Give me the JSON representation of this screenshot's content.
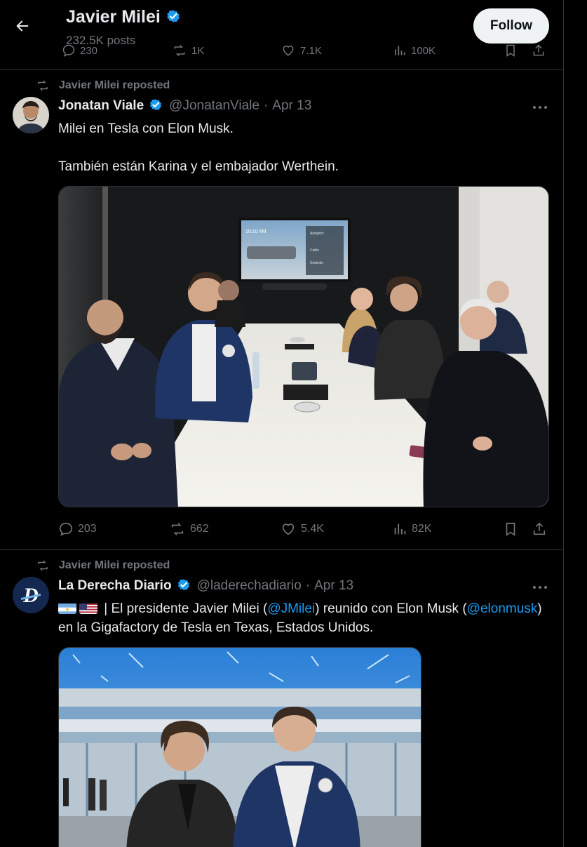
{
  "header": {
    "name": "Javier Milei",
    "posts": "232.5K posts",
    "follow_label": "Follow",
    "prev_counts": {
      "replies": "230",
      "reposts": "1K",
      "likes": "7.1K",
      "views": "100K"
    }
  },
  "tweets": [
    {
      "repost_label": "Javier Milei reposted",
      "author_name": "Jonatan Viale",
      "handle": "@JonatanViale",
      "separator": "·",
      "date": "Apr 13",
      "text_line1": "Milei en Tesla con Elon Musk.",
      "text_line2": "También están Karina y el embajador Werthein.",
      "actions": {
        "replies": "203",
        "reposts": "662",
        "likes": "5.4K",
        "views": "82K"
      },
      "screen": {
        "time": "10:10 AM",
        "panel1": "Autopilot",
        "panel2": "Cabin",
        "panel3": "Controls"
      }
    },
    {
      "repost_label": "Javier Milei reposted",
      "author_name": "La Derecha Diario",
      "handle": "@laderechadiario",
      "separator": "·",
      "date": "Apr 13",
      "avatar_letter": "D",
      "text_part1": " | El presidente Javier Milei (",
      "mention1": "@JMilei",
      "text_part2": ") reunido con Elon Musk (",
      "mention2": "@elonmusk",
      "text_part3": ")",
      "text_line2": "en la Gigafactory de Tesla en Texas, Estados Unidos."
    }
  ],
  "icons": {
    "back": "arrow-left-icon",
    "verified": "verified-badge-icon",
    "repost": "repost-icon",
    "reply": "reply-icon",
    "like": "heart-icon",
    "views": "bar-chart-icon",
    "bookmark": "bookmark-icon",
    "share": "share-icon",
    "more": "more-horizontal-icon"
  },
  "colors": {
    "accent": "#1d9bf0",
    "muted": "#71767b",
    "border": "#2f3336",
    "text": "#e7e9ea"
  }
}
